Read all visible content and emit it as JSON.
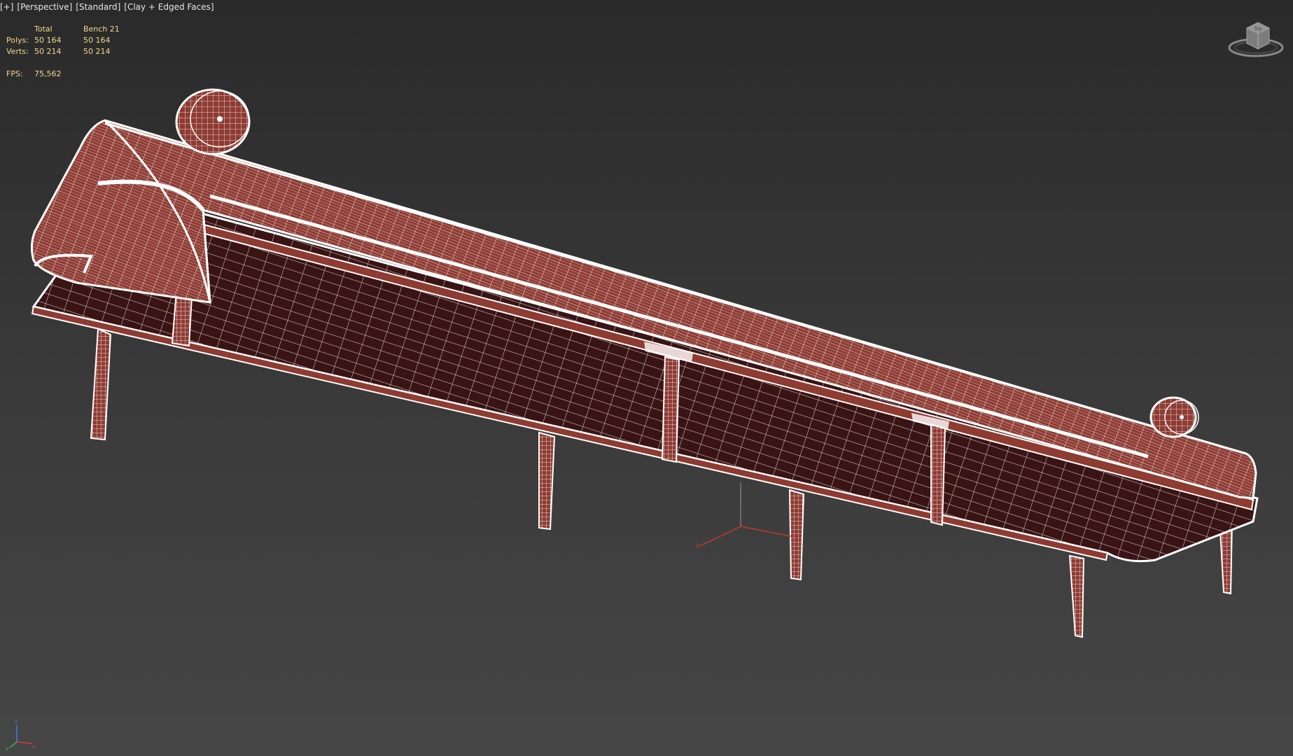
{
  "viewport": {
    "label_segments": [
      "[+]",
      "[Perspective]",
      "[Standard]",
      "[Clay + Edged Faces]"
    ]
  },
  "stats": {
    "header": {
      "col_total": "Total",
      "col_object": "Bench 21"
    },
    "polys": {
      "label": "Polys:",
      "total": "50 164",
      "object": "50 164"
    },
    "verts": {
      "label": "Verts:",
      "total": "50 214",
      "object": "50 214"
    },
    "fps": {
      "label": "FPS:",
      "value": "75,562"
    }
  },
  "viewcube": {
    "label": "Top"
  },
  "axis_tripod": {
    "x": "x",
    "y": "y",
    "z": "z"
  },
  "colors": {
    "stats_text": "#f0d98a",
    "model_fill": "#8e3b32",
    "model_dark": "#3a1414",
    "wire": "#ffffff",
    "background_top": "#2a2a2a",
    "background_bottom": "#464646"
  }
}
